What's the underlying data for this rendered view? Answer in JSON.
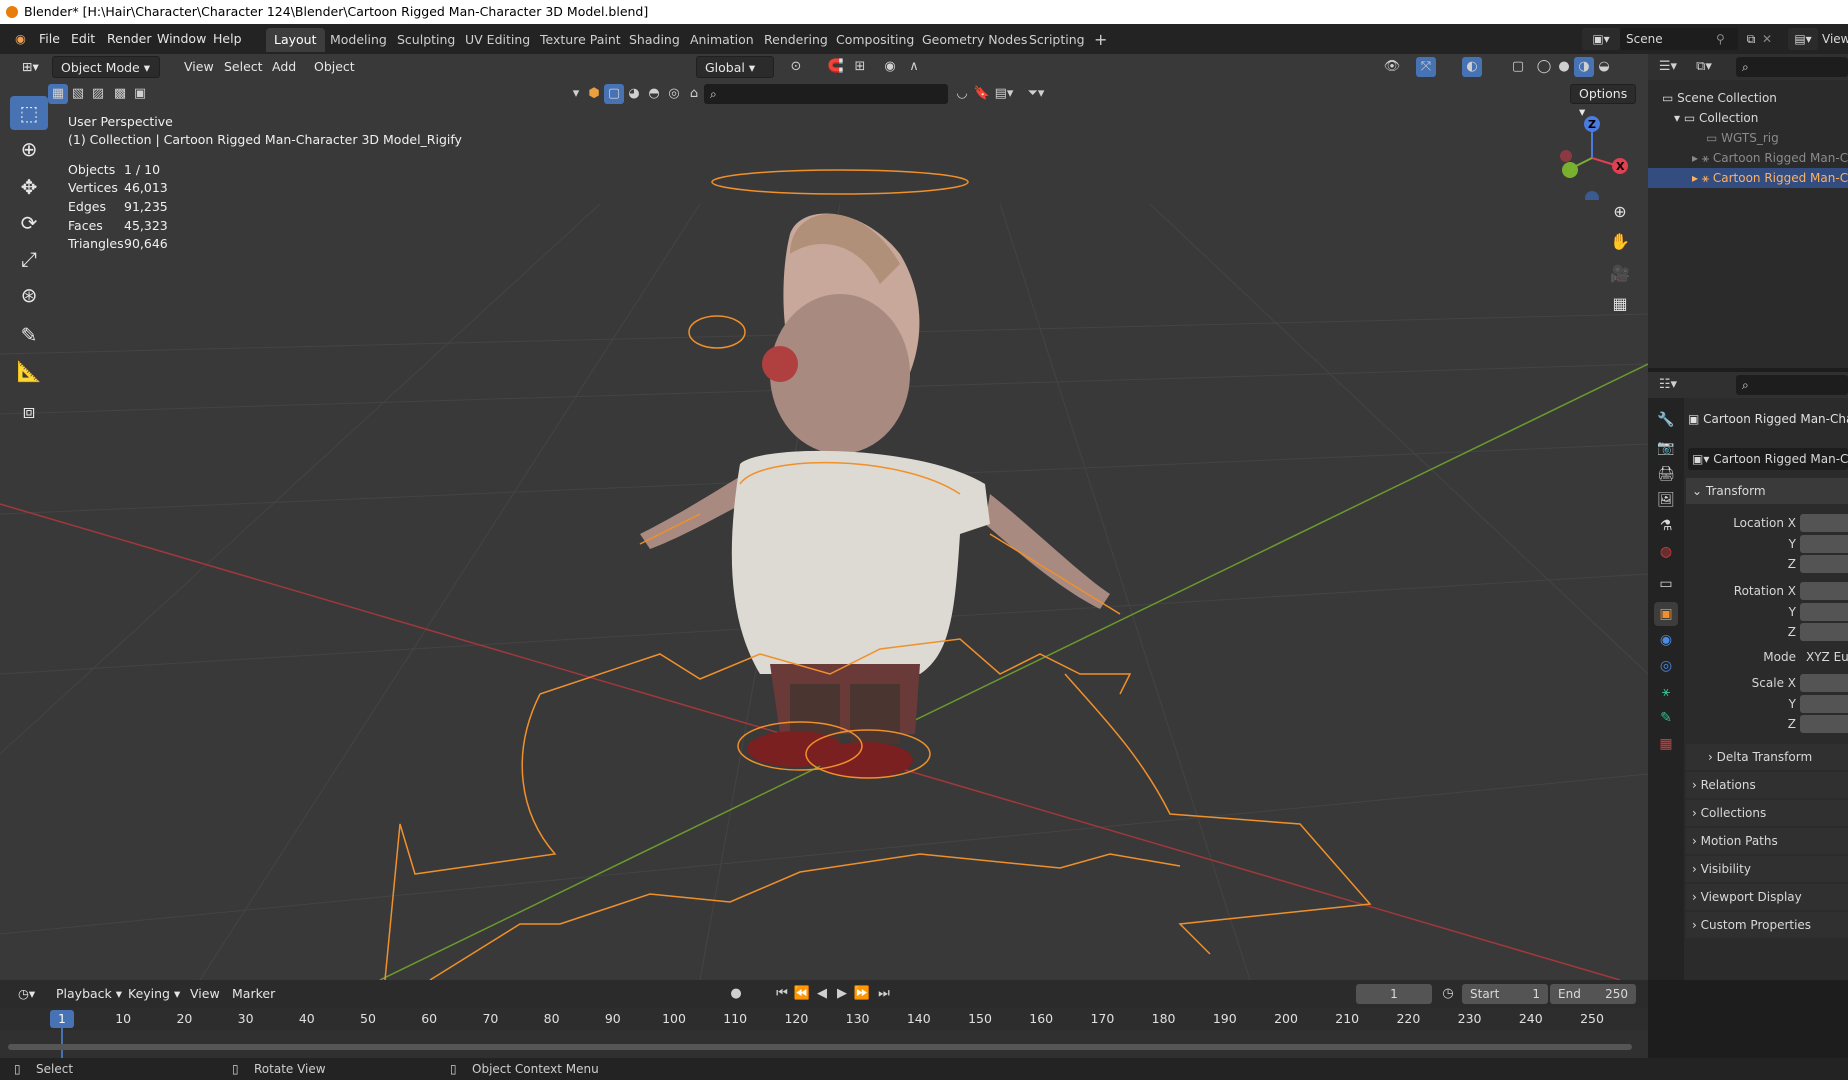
{
  "window": {
    "title": "Blender* [H:\\Hair\\Character\\Character 124\\Blender\\Cartoon Rigged Man-Character 3D Model.blend]"
  },
  "menus": [
    "File",
    "Edit",
    "Render",
    "Window",
    "Help"
  ],
  "workspaces": [
    "Layout",
    "Modeling",
    "Sculpting",
    "UV Editing",
    "Texture Paint",
    "Shading",
    "Animation",
    "Rendering",
    "Compositing",
    "Geometry Nodes",
    "Scripting"
  ],
  "active_workspace": "Layout",
  "scene": {
    "label": "Scene",
    "view_layer": "View"
  },
  "viewport": {
    "mode": "Object Mode",
    "menus": [
      "View",
      "Select",
      "Add",
      "Object"
    ],
    "orientation": "Global",
    "options_label": "Options",
    "perspective": "User Perspective",
    "collection_info": "(1) Collection | Cartoon Rigged Man-Character 3D Model_Rigify",
    "stats": [
      {
        "label": "Objects",
        "value": "1 / 10"
      },
      {
        "label": "Vertices",
        "value": "46,013"
      },
      {
        "label": "Edges",
        "value": "91,235"
      },
      {
        "label": "Faces",
        "value": "45,323"
      },
      {
        "label": "Triangles",
        "value": "90,646"
      }
    ],
    "gizmo": {
      "z": "Z",
      "x": "X"
    }
  },
  "outliner": {
    "rows": [
      {
        "label": "Scene Collection",
        "selected": false
      },
      {
        "label": "Collection",
        "selected": false
      },
      {
        "label": "WGTS_rig",
        "selected": false
      },
      {
        "label": "Cartoon Rigged Man-C",
        "selected": false
      },
      {
        "label": "Cartoon Rigged Man-C",
        "selected": true
      }
    ]
  },
  "properties": {
    "object_name": "Cartoon Rigged Man-Chara",
    "datablock": "Cartoon Rigged Man-Cha",
    "transform": {
      "title": "Transform",
      "location_label": "Location X",
      "rotation_label": "Rotation X",
      "mode_label": "Mode",
      "mode_value": "XYZ Eul",
      "scale_label": "Scale X",
      "y": "Y",
      "z": "Z"
    },
    "sections": [
      "Delta Transform",
      "Relations",
      "Collections",
      "Motion Paths",
      "Visibility",
      "Viewport Display",
      "Custom Properties"
    ]
  },
  "timeline": {
    "menus": [
      "Playback",
      "Keying",
      "View",
      "Marker"
    ],
    "current_frame": "1",
    "start_label": "Start",
    "start": "1",
    "end_label": "End",
    "end": "250",
    "ruler": [
      "10",
      "20",
      "30",
      "40",
      "50",
      "60",
      "70",
      "80",
      "90",
      "100",
      "110",
      "120",
      "130",
      "140",
      "150",
      "160",
      "170",
      "180",
      "190",
      "200",
      "210",
      "220",
      "230",
      "240",
      "250"
    ],
    "playhead": "1"
  },
  "statusbar": {
    "items": [
      "Select",
      "Rotate View",
      "Object Context Menu"
    ]
  }
}
